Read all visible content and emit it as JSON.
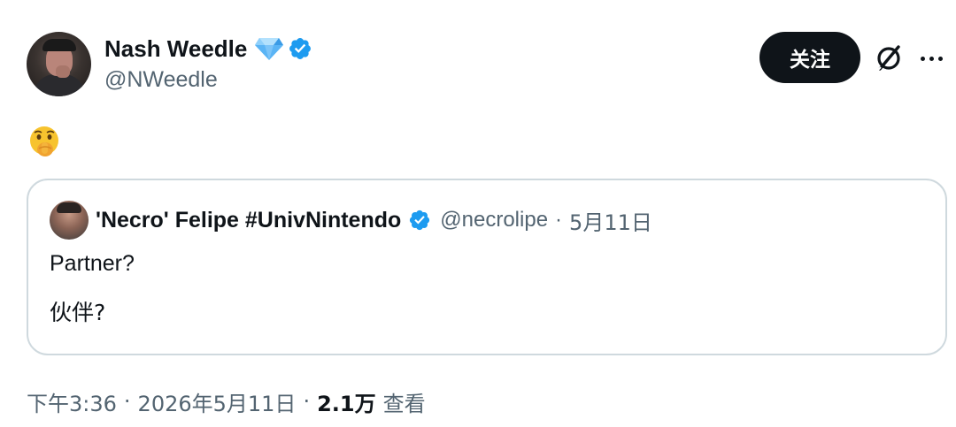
{
  "author": {
    "display_name": "Nash Weedle",
    "handle": "@NWeedle",
    "badges": [
      "gem-icon",
      "verified-icon"
    ]
  },
  "actions": {
    "follow_label": "关注",
    "grok_icon": "grok-icon",
    "more_icon": "more-icon"
  },
  "body": {
    "emoji": "shushing-face-emoji"
  },
  "quote": {
    "display_name": "'Necro' Felipe #UnivNintendo",
    "handle": "@necrolipe",
    "separator": "·",
    "date": "5月11日",
    "line1": "Partner?",
    "line2": "伙伴?"
  },
  "meta": {
    "time": "下午3:36",
    "separator": "·",
    "date": "2026年5月11日",
    "views_count": "2.1万",
    "views_label": "查看"
  },
  "colors": {
    "verified_blue": "#1d9bf0",
    "text_primary": "#0f1419",
    "text_secondary": "#536471",
    "border": "#cfd9de",
    "gem": "#5ab4f5"
  }
}
